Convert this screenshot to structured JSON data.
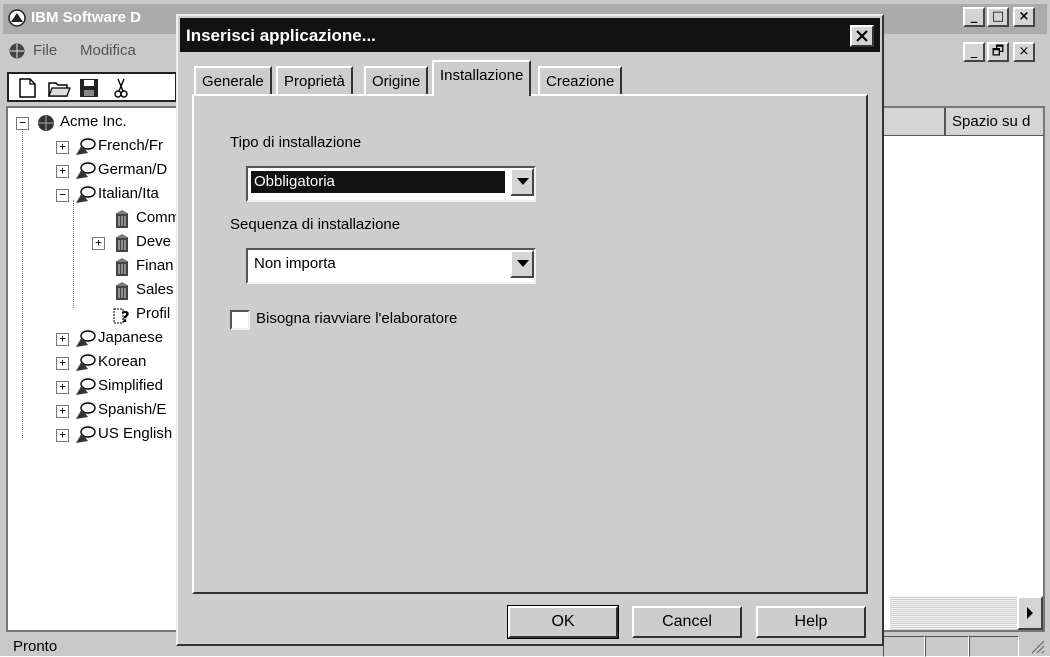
{
  "main_window": {
    "title": "IBM Software D",
    "caption_buttons": {
      "minimize": "_",
      "maximize": "□",
      "close": "×",
      "mdi_minimize": "_",
      "mdi_restore": "🗗",
      "mdi_close": "×"
    },
    "menu": [
      "File",
      "Modifica"
    ],
    "toolbar_icons": [
      "new-document-icon",
      "open-folder-icon",
      "save-disk-icon",
      "cut-scissors-icon"
    ],
    "tree": [
      {
        "label": "Acme Inc.",
        "icon": "globe-icon",
        "expander": "−"
      },
      {
        "label": "French/Fr",
        "icon": "speech-bubble-icon",
        "expander": "+"
      },
      {
        "label": "German/D",
        "icon": "speech-bubble-icon",
        "expander": "+"
      },
      {
        "label": "Italian/Ita",
        "icon": "speech-bubble-icon",
        "expander": "−"
      },
      {
        "label": "Comm",
        "icon": "building-icon",
        "expander": ""
      },
      {
        "label": "Deve",
        "icon": "building-icon",
        "expander": "+"
      },
      {
        "label": "Finan",
        "icon": "building-icon",
        "expander": ""
      },
      {
        "label": "Sales",
        "icon": "building-icon",
        "expander": ""
      },
      {
        "label": "Profil",
        "icon": "question-profile-icon",
        "expander": ""
      },
      {
        "label": "Japanese",
        "icon": "speech-bubble-icon",
        "expander": "+"
      },
      {
        "label": "Korean",
        "icon": "speech-bubble-icon",
        "expander": "+"
      },
      {
        "label": "Simplified",
        "icon": "speech-bubble-icon",
        "expander": "+"
      },
      {
        "label": "Spanish/E",
        "icon": "speech-bubble-icon",
        "expander": "+"
      },
      {
        "label": "US English",
        "icon": "speech-bubble-icon",
        "expander": "+"
      }
    ],
    "list_header": {
      "col2": "Spazio su d"
    },
    "status": "Pronto"
  },
  "dialog": {
    "title": "Inserisci applicazione...",
    "close": "×",
    "tabs": [
      "Generale",
      "Proprietà",
      "Origine",
      "Installazione",
      "Creazione"
    ],
    "active_tab": "Installazione",
    "install_type_label": "Tipo di installazione",
    "install_type_value": "Obbligatoria",
    "install_sequence_label": "Sequenza di installazione",
    "install_sequence_value": "Non importa",
    "reboot_checkbox_label": "Bisogna riavviare l'elaboratore",
    "reboot_checked": false,
    "buttons": {
      "ok": "OK",
      "cancel": "Cancel",
      "help": "Help"
    }
  }
}
